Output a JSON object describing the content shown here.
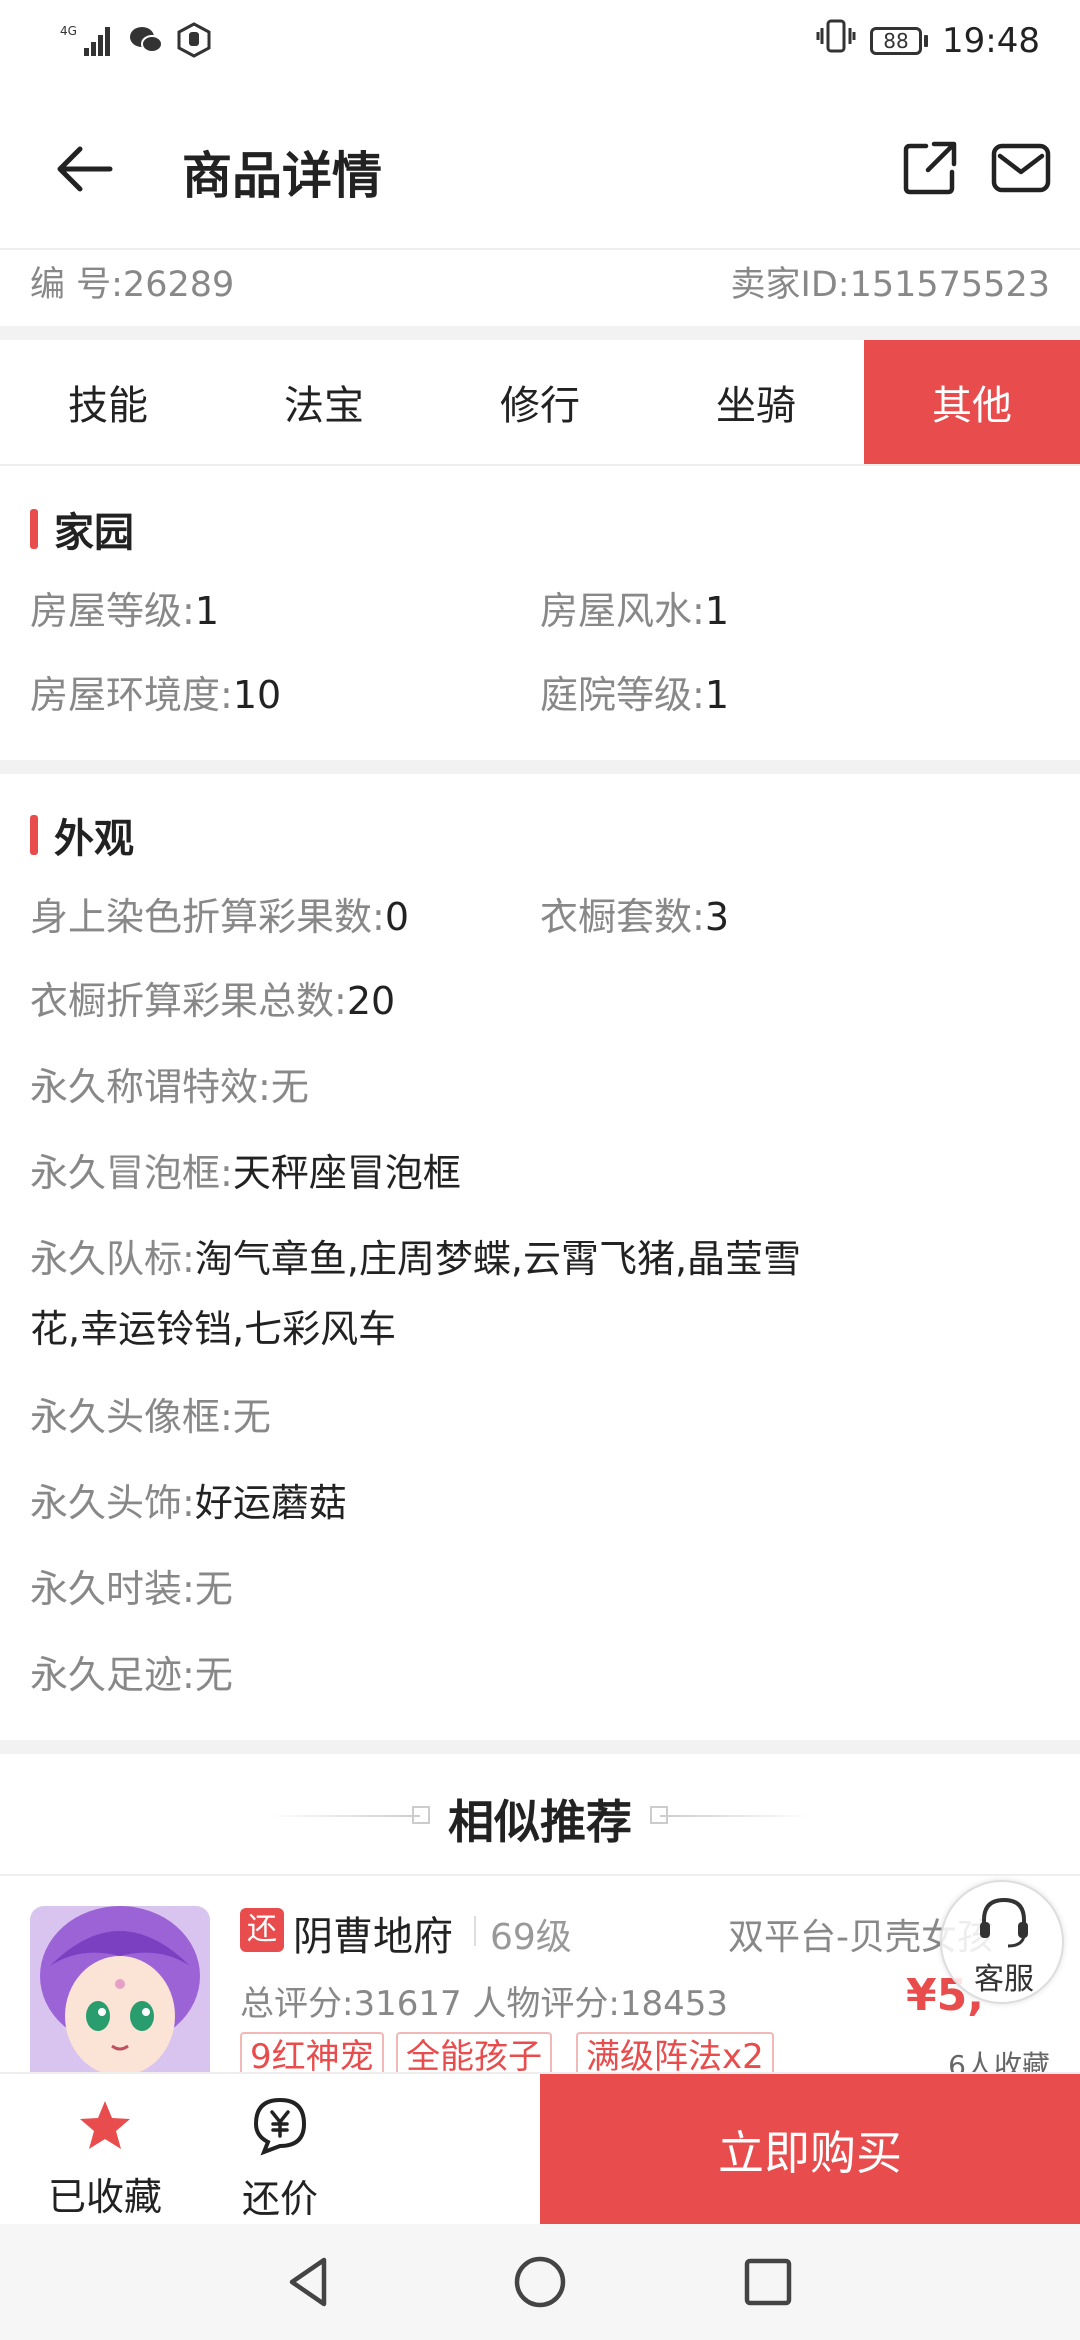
{
  "status_bar": {
    "network": "4G",
    "battery": "88",
    "time": "19:48"
  },
  "header": {
    "title": "商品详情",
    "icons": [
      "back-arrow-icon",
      "share-icon",
      "mail-icon"
    ]
  },
  "item_id": {
    "number_label": "编 号:",
    "number_value": "26289",
    "seller_label": "卖家ID:",
    "seller_value": "151575523"
  },
  "tabs": [
    {
      "label": "技能",
      "active": false
    },
    {
      "label": "法宝",
      "active": false
    },
    {
      "label": "修行",
      "active": false
    },
    {
      "label": "坐骑",
      "active": false
    },
    {
      "label": "其他",
      "active": true
    }
  ],
  "home_section": {
    "title": "家园",
    "fields": [
      {
        "label": "房屋等级:",
        "value": "1"
      },
      {
        "label": "房屋风水:",
        "value": "1"
      },
      {
        "label": "房屋环境度:",
        "value": "10"
      },
      {
        "label": "庭院等级:",
        "value": "1"
      }
    ]
  },
  "appearance_section": {
    "title": "外观",
    "fields": [
      {
        "label": "身上染色折算彩果数:",
        "value": "0"
      },
      {
        "label": "衣橱套数:",
        "value": "3"
      },
      {
        "label": "衣橱折算彩果总数:",
        "value": "20"
      },
      {
        "label": "永久称谓特效:",
        "value": "无"
      },
      {
        "label": "永久冒泡框:",
        "value": "天秤座冒泡框"
      },
      {
        "label": "永久队标:",
        "value": "淘气章鱼,庄周梦蝶,云霄飞猪,晶莹雪",
        "value_cont": "花,幸运铃铛,七彩风车"
      },
      {
        "label": "永久头像框:",
        "value": "无"
      },
      {
        "label": "永久头饰:",
        "value": "好运蘑菇"
      },
      {
        "label": "永久时装:",
        "value": "无"
      },
      {
        "label": "永久足迹:",
        "value": "无"
      }
    ]
  },
  "recommend": {
    "title": "相似推荐",
    "item": {
      "badge": "还",
      "server": "阴曹地府",
      "level": "69级",
      "platform": "双平台-贝壳女孩",
      "score": "总评分:31617 人物评分:18453",
      "price": "¥5,",
      "favorites": "6人收藏",
      "tags": [
        "9红神宠",
        "全能孩子",
        "满级阵法x2"
      ]
    }
  },
  "customer_service": {
    "label": "客服"
  },
  "bottom_bar": {
    "fav_label": "已收藏",
    "bargain_label": "还价",
    "buy_label": "立即购买"
  },
  "colors": {
    "accent": "#e84c4c",
    "label_gray": "#888888",
    "text_dark": "#222222",
    "divider": "#f2f2f2"
  }
}
